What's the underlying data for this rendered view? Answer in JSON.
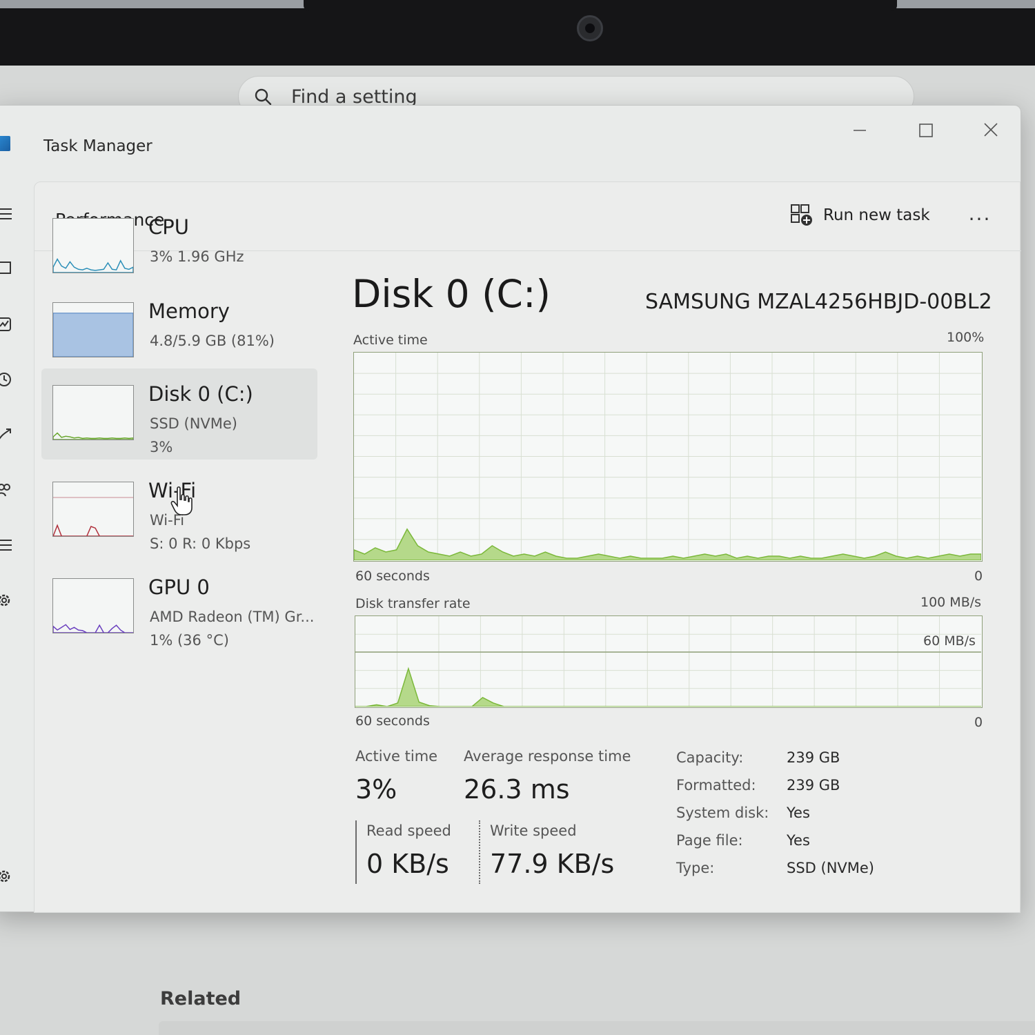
{
  "settings_backdrop": {
    "search_placeholder": "Find a setting",
    "related_heading": "Related"
  },
  "window": {
    "title": "Task Manager",
    "page_title": "Performance",
    "run_new_task_label": "Run new task",
    "more_label": "..."
  },
  "devices": [
    {
      "name": "CPU",
      "sub1": "3%  1.96 GHz",
      "sub2": "",
      "color": "#2b8fb8"
    },
    {
      "name": "Memory",
      "sub1": "4.8/5.9 GB (81%)",
      "sub2": "",
      "color": "#4a7fbf"
    },
    {
      "name": "Disk 0 (C:)",
      "sub1": "SSD (NVMe)",
      "sub2": "3%",
      "color": "#6aa82f"
    },
    {
      "name": "Wi-Fi",
      "sub1": "Wi-Fi",
      "sub2": "S: 0  R: 0 Kbps",
      "color": "#b0303c"
    },
    {
      "name": "GPU 0",
      "sub1": "AMD Radeon (TM) Gr...",
      "sub2": "1%  (36 °C)",
      "color": "#6a3fbf"
    }
  ],
  "detail": {
    "title": "Disk 0 (C:)",
    "model": "SAMSUNG MZAL4256HBJD-00BL2",
    "active_chart": {
      "label": "Active time",
      "max_label": "100%",
      "time_label": "60 seconds",
      "min_label": "0"
    },
    "transfer_chart": {
      "label": "Disk transfer rate",
      "max_label": "100 MB/s",
      "mid_label": "60 MB/s",
      "time_label": "60 seconds",
      "min_label": "0"
    },
    "stats": {
      "active_time_label": "Active time",
      "active_time_value": "3%",
      "avg_response_label": "Average response time",
      "avg_response_value": "26.3 ms",
      "read_label": "Read speed",
      "read_value": "0 KB/s",
      "write_label": "Write speed",
      "write_value": "77.9 KB/s"
    },
    "properties": [
      {
        "key": "Capacity:",
        "value": "239 GB"
      },
      {
        "key": "Formatted:",
        "value": "239 GB"
      },
      {
        "key": "System disk:",
        "value": "Yes"
      },
      {
        "key": "Page file:",
        "value": "Yes"
      },
      {
        "key": "Type:",
        "value": "SSD (NVMe)"
      }
    ]
  },
  "graph_color": "#7bb83a",
  "graph_fill": "#b5d98a"
}
